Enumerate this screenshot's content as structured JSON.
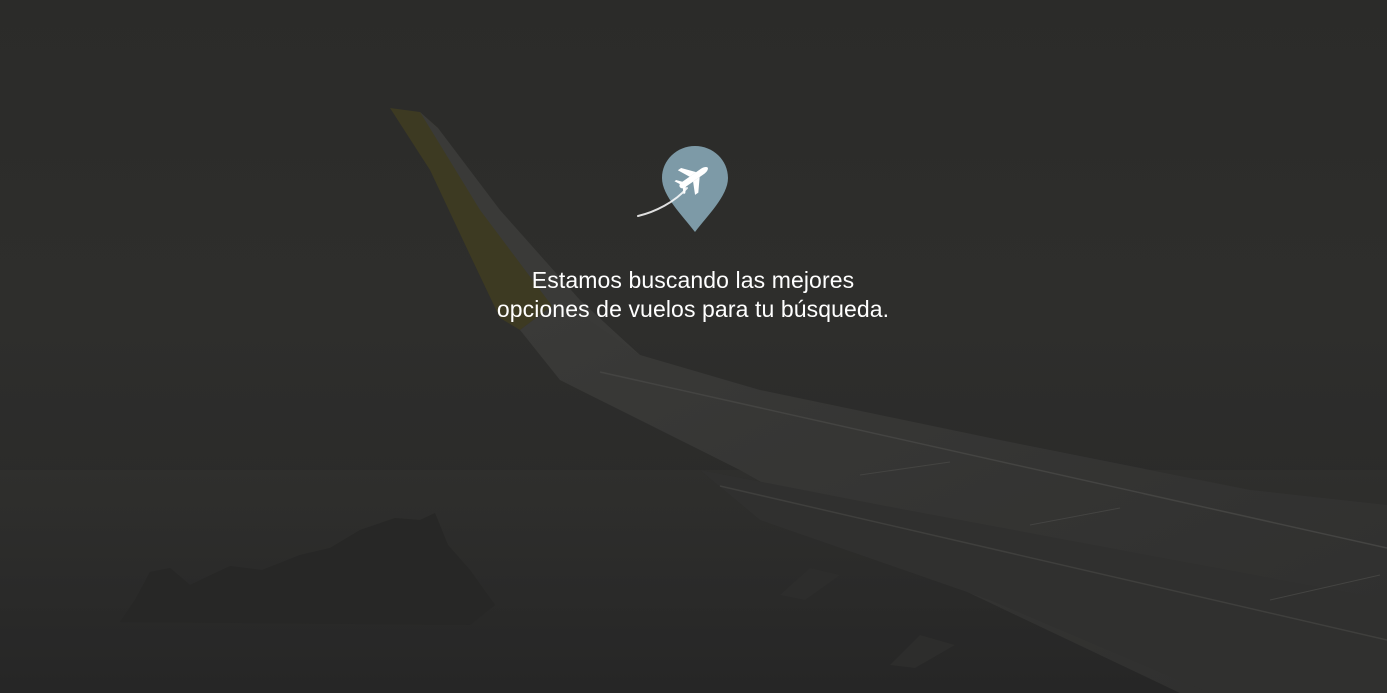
{
  "loader": {
    "icon": "plane-location-pin-icon",
    "message_line_1": "Estamos buscando las mejores",
    "message_line_2": "opciones de vuelos para tu búsqueda."
  },
  "background": {
    "image": "airplane-wing-over-sea-photo",
    "overlay_color": "#2b2b29"
  },
  "colors": {
    "pin": "#7d9aa7",
    "text": "#ffffff"
  }
}
